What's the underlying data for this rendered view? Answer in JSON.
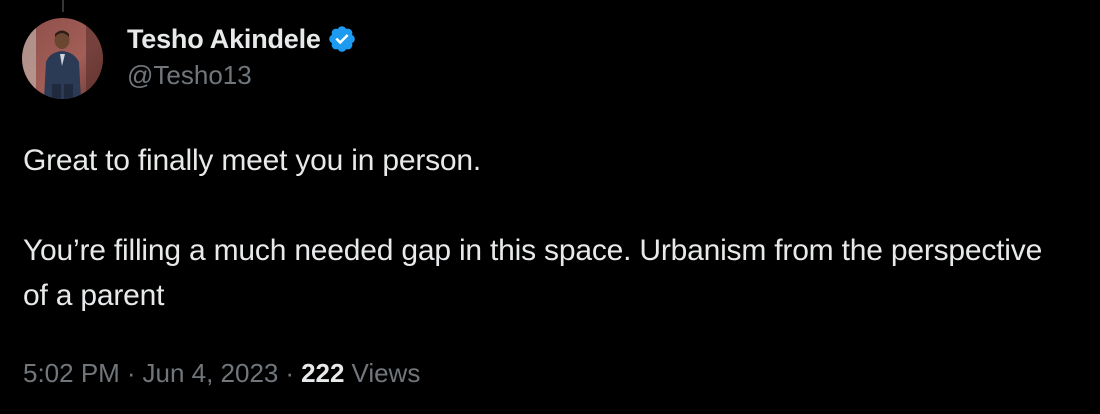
{
  "author": {
    "display_name": "Tesho Akindele",
    "handle": "@Tesho13",
    "verified": true,
    "avatar_icon": "profile-photo-icon"
  },
  "tweet": {
    "paragraphs": [
      "Great to finally meet you in person.",
      "You’re filling a much needed gap in this space. Urbanism from the perspective of a parent"
    ]
  },
  "meta": {
    "time": "5:02 PM",
    "separator": "·",
    "date": "Jun 4, 2023",
    "views_count": "222",
    "views_label": "Views"
  },
  "colors": {
    "background": "#000000",
    "text_primary": "#e7e9ea",
    "text_secondary": "#71767b",
    "verified_badge": "#1d9bf0"
  }
}
